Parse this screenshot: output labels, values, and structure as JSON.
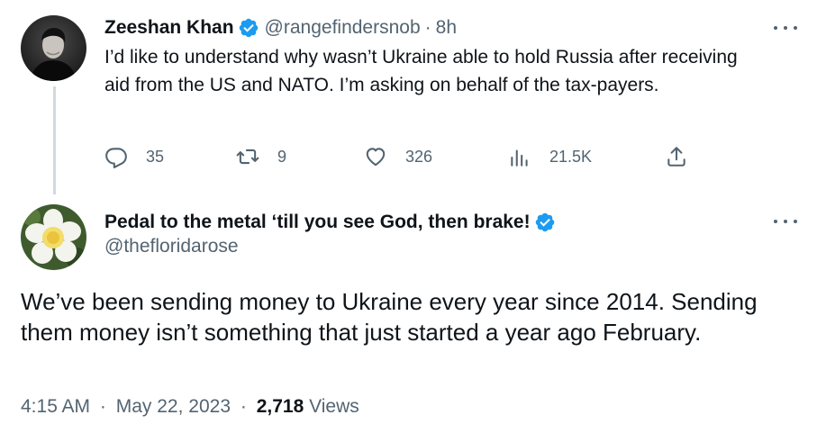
{
  "parent_tweet": {
    "author": {
      "display_name": "Zeeshan Khan",
      "handle": "@rangefindersnob",
      "verified": true
    },
    "time_ago": "8h",
    "separator": "·",
    "text": "I’d like to understand why wasn’t Ukraine able to hold Russia after receiving aid from the US and NATO. I’m asking on behalf of the tax-payers.",
    "actions": {
      "replies": "35",
      "retweets": "9",
      "likes": "326",
      "views": "21.5K"
    },
    "icons": [
      "reply-icon",
      "retweet-icon",
      "like-icon",
      "views-icon",
      "share-icon",
      "more-icon"
    ]
  },
  "reply_tweet": {
    "author": {
      "display_name": "Pedal to the metal ‘till you see God, then brake!",
      "handle": "@thefloridarose",
      "verified": true
    },
    "text": "We’ve been sending money to Ukraine every year since 2014. Sending them money isn’t something that just started a year ago February.",
    "meta": {
      "time": "4:15 AM",
      "separator": "·",
      "date": "May 22, 2023",
      "views_count": "2,718",
      "views_label": "Views"
    }
  },
  "colors": {
    "verified_blue": "#1d9bf0",
    "muted_text": "#536471",
    "primary_text": "#0f1419",
    "thread_line": "#cfd9de"
  }
}
